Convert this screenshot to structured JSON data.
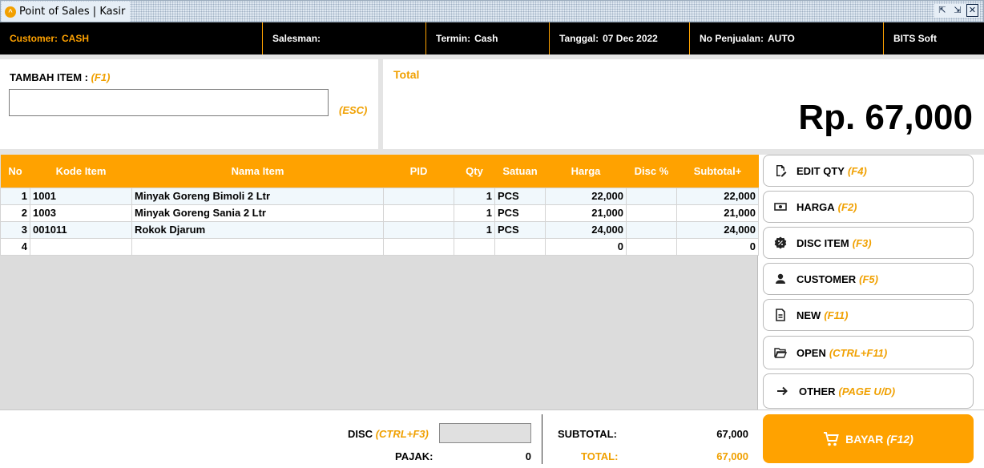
{
  "window": {
    "title": "Point of Sales | Kasir",
    "buttons": [
      "restore",
      "minimize",
      "close"
    ]
  },
  "infobar": {
    "customer_label": "Customer:",
    "customer_value": "CASH",
    "salesman_label": "Salesman:",
    "salesman_value": "",
    "termin_label": "Termin:",
    "termin_value": "Cash",
    "tanggal_label": "Tanggal:",
    "tanggal_value": "07 Dec 2022",
    "no_label": "No Penjualan:",
    "no_value": "AUTO",
    "brand": "BITS Soft"
  },
  "input": {
    "label": "TAMBAH ITEM :",
    "hotkey": "(F1)",
    "value": "",
    "esc_hint": "(ESC)"
  },
  "total": {
    "label": "Total",
    "value": "Rp. 67,000"
  },
  "grid": {
    "columns": [
      "No",
      "Kode Item",
      "Nama Item",
      "PID",
      "Qty",
      "Satuan",
      "Harga",
      "Disc %",
      "Subtotal+"
    ],
    "rows": [
      {
        "no": "1",
        "kode": "1001",
        "nama": "Minyak Goreng Bimoli 2 Ltr",
        "pid": "",
        "qty": "1",
        "satuan": "PCS",
        "harga": "22,000",
        "disc": "",
        "subtotal": "22,000"
      },
      {
        "no": "2",
        "kode": "1003",
        "nama": "Minyak Goreng Sania 2 Ltr",
        "pid": "",
        "qty": "1",
        "satuan": "PCS",
        "harga": "21,000",
        "disc": "",
        "subtotal": "21,000"
      },
      {
        "no": "3",
        "kode": "001011",
        "nama": "Rokok Djarum",
        "pid": "",
        "qty": "1",
        "satuan": "PCS",
        "harga": "24,000",
        "disc": "",
        "subtotal": "24,000"
      },
      {
        "no": "4",
        "kode": "",
        "nama": "",
        "pid": "",
        "qty": "",
        "satuan": "",
        "harga": "0",
        "disc": "",
        "subtotal": "0"
      }
    ]
  },
  "side_buttons": [
    {
      "label": "EDIT QTY",
      "hotkey": "(F4)",
      "icon": "edit-icon"
    },
    {
      "label": "HARGA",
      "hotkey": "(F2)",
      "icon": "money-icon"
    },
    {
      "label": "DISC ITEM",
      "hotkey": "(F3)",
      "icon": "discount-badge-icon"
    },
    {
      "label": "CUSTOMER",
      "hotkey": "(F5)",
      "icon": "person-icon"
    },
    {
      "label": "NEW",
      "hotkey": "(F11)",
      "icon": "new-file-icon"
    },
    {
      "label": "OPEN",
      "hotkey": "(CTRL+F11)",
      "icon": "folder-open-icon"
    },
    {
      "label": "OTHER",
      "hotkey": "(PAGE U/D)",
      "icon": "arrow-right-icon"
    }
  ],
  "bottom": {
    "disc_label": "DISC",
    "disc_hotkey": "(CTRL+F3)",
    "disc_value": "",
    "pajak_label": "PAJAK:",
    "pajak_value": "0",
    "subtotal_label": "SUBTOTAL:",
    "subtotal_value": "67,000",
    "total_label": "TOTAL:",
    "total_value": "67,000",
    "bayar_label": "BAYAR",
    "bayar_hotkey": "(F12)"
  },
  "colors": {
    "accent": "#ffa200",
    "header_bg": "#000000",
    "grid_bg": "#dcdcdc",
    "row_alt": "#f1f8fc"
  }
}
